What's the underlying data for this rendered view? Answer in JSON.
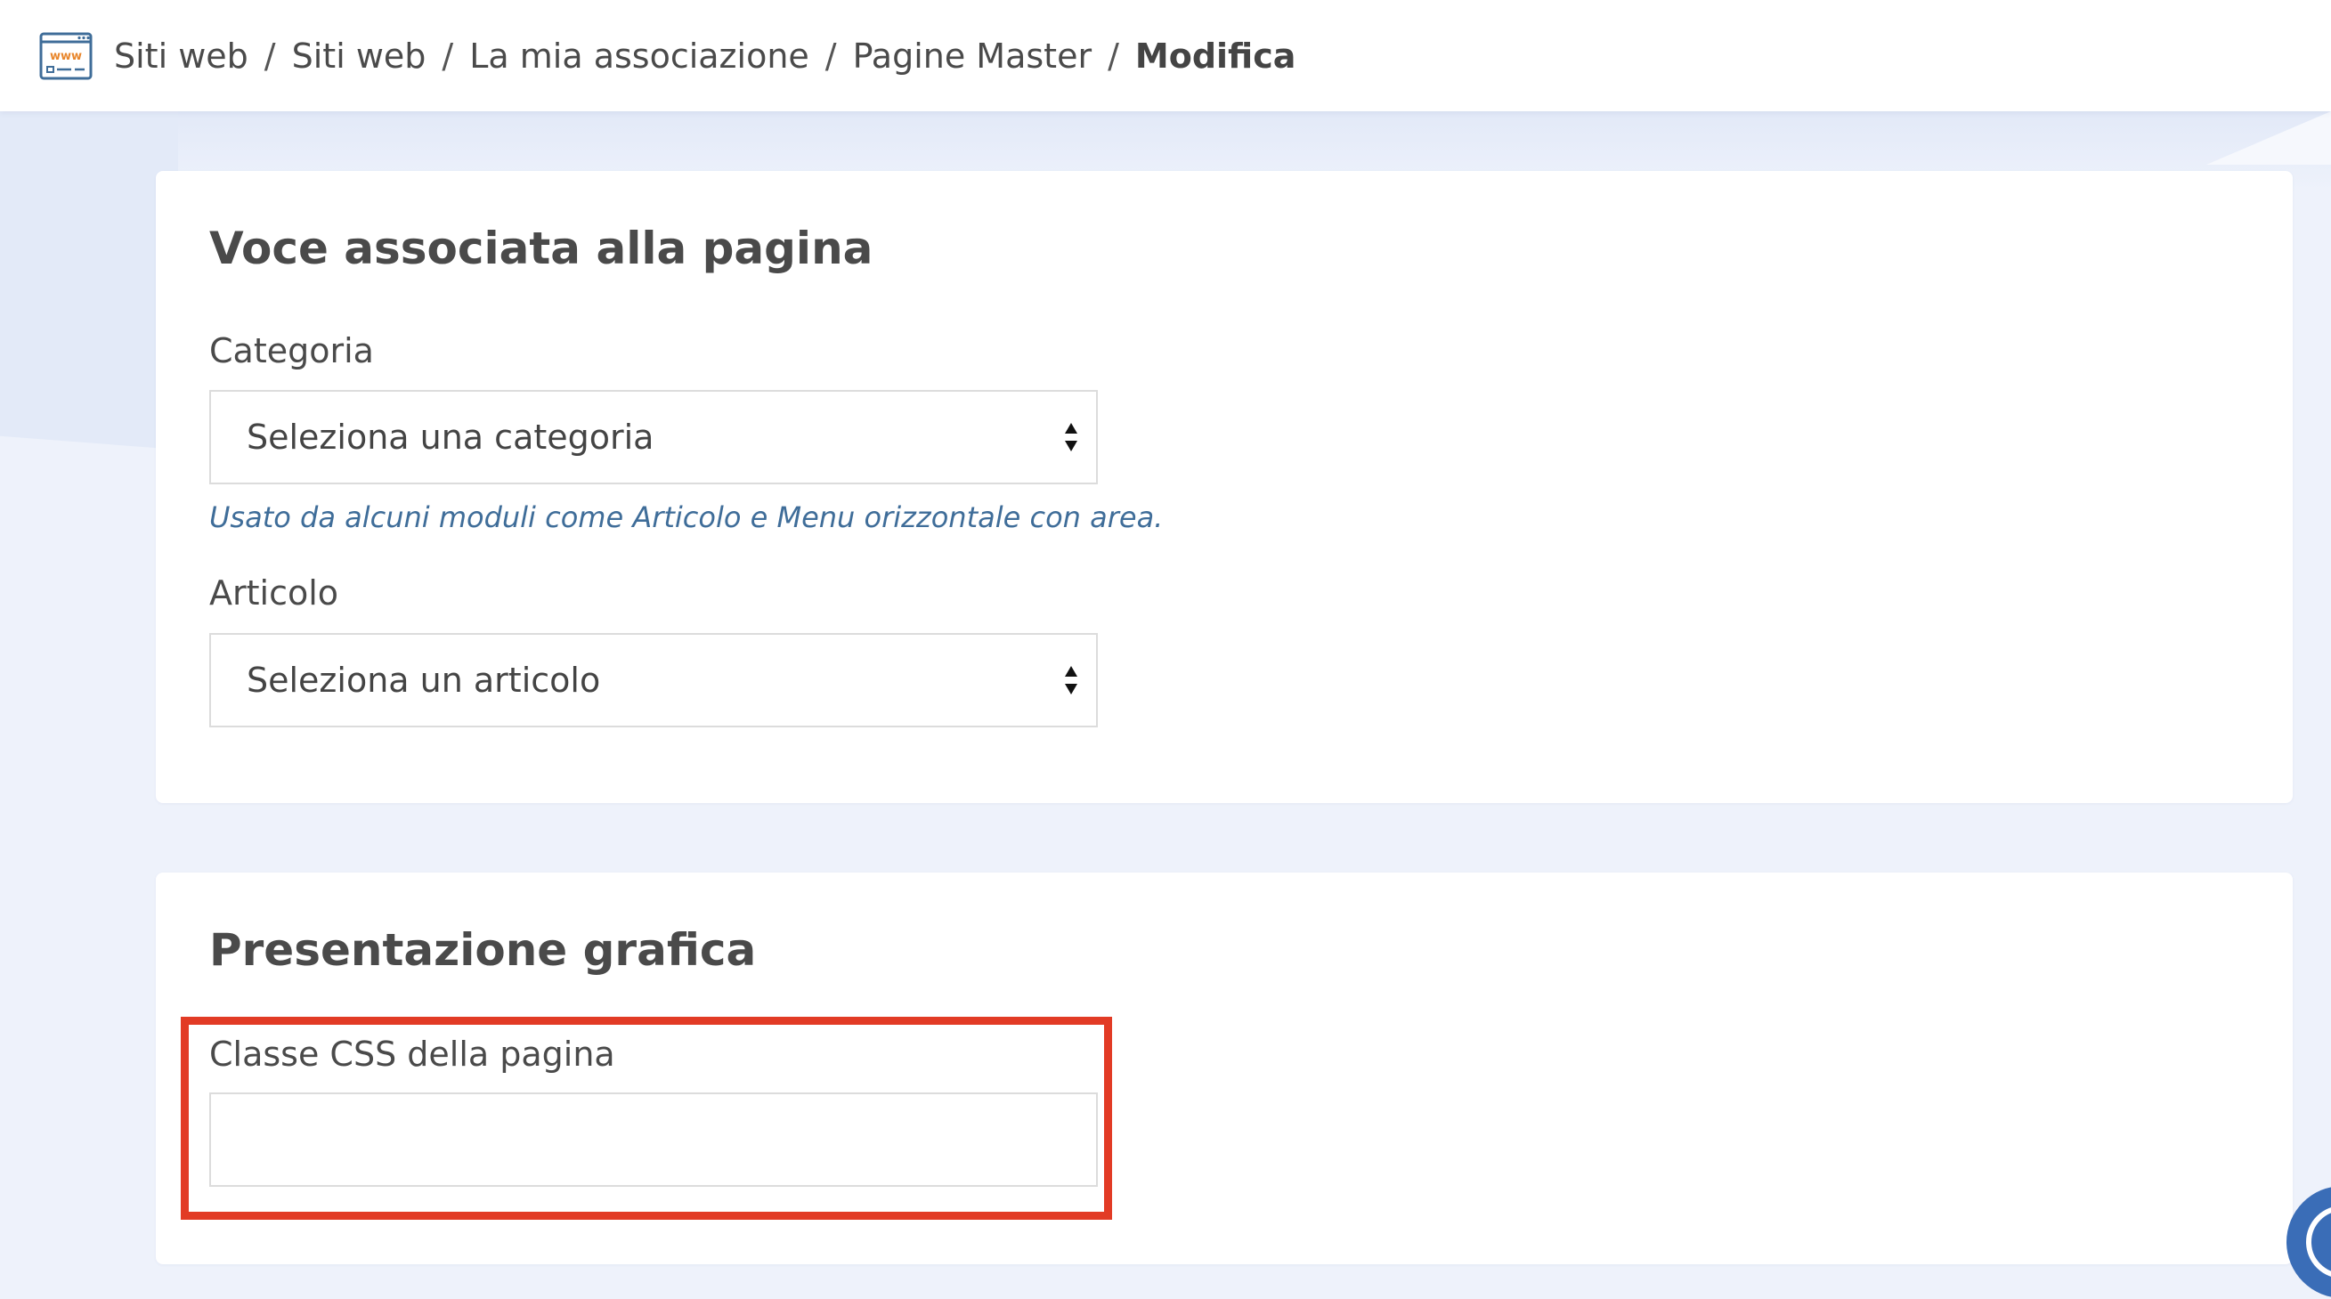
{
  "breadcrumb": {
    "items": [
      "Siti web",
      "Siti web",
      "La mia associazione",
      "Pagine Master"
    ],
    "current": "Modifica",
    "separator": "/"
  },
  "header": {
    "site_icon_text": "www"
  },
  "section_page_item": {
    "title": "Voce associata alla pagina",
    "category": {
      "label": "Categoria",
      "value": "Seleziona una categoria",
      "help": "Usato da alcuni moduli come Articolo e Menu orizzontale con area."
    },
    "article": {
      "label": "Articolo",
      "value": "Seleziona un articolo"
    }
  },
  "section_graphics": {
    "title": "Presentazione grafica",
    "css_class": {
      "label": "Classe CSS della pagina",
      "value": ""
    }
  },
  "colors": {
    "highlight": "#e23b25",
    "help_text": "#3f6d99",
    "widget": "#3a6db7",
    "background": "#eef2fb"
  }
}
